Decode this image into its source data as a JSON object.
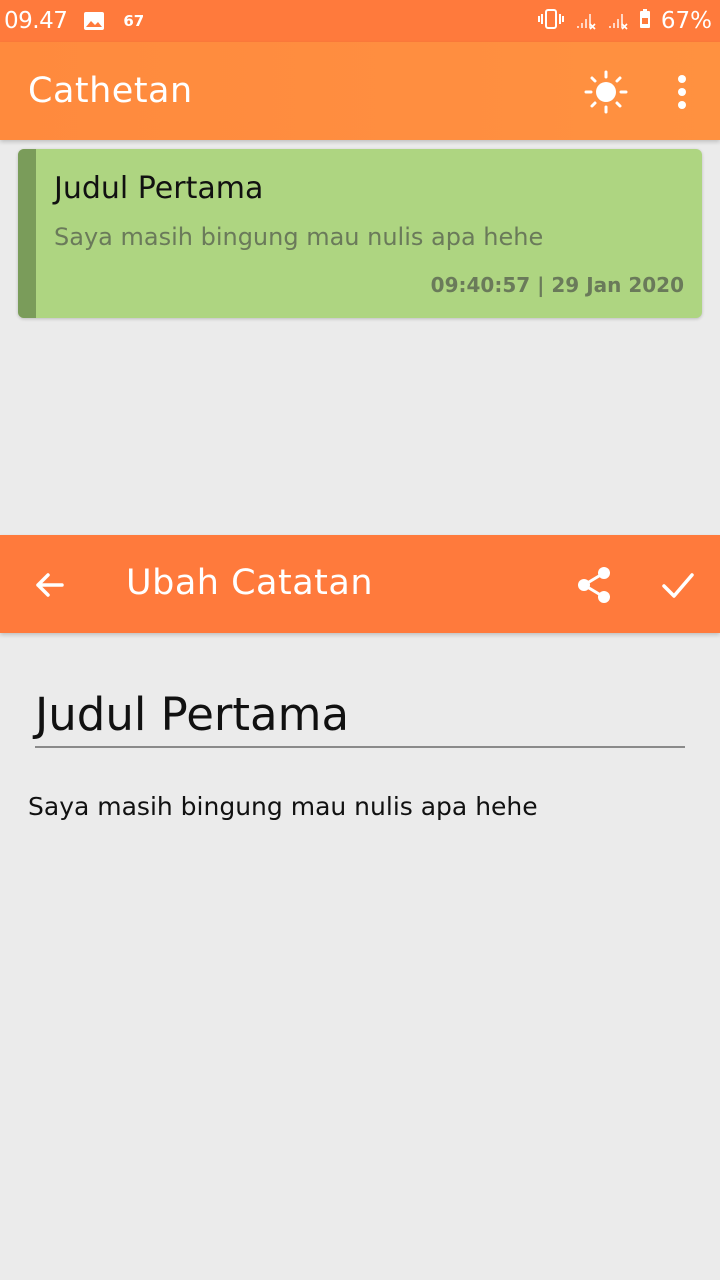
{
  "status_bar": {
    "time": "09.47",
    "notification_count": "67",
    "battery": "67%",
    "icons": [
      "image-icon",
      "vibrate-icon",
      "signal-icon",
      "signal-icon",
      "battery-icon"
    ]
  },
  "app_bar": {
    "title": "Cathetan",
    "theme_icon": "sun-icon",
    "menu_icon": "more-vert-icon"
  },
  "notes": [
    {
      "title": "Judul Pertama",
      "body": "Saya masih bingung mau nulis apa hehe",
      "timestamp": "09:40:57 | 29 Jan 2020",
      "color": "#aed581"
    }
  ],
  "edit_sheet": {
    "title": "Ubah Catatan",
    "back_icon": "arrow-back-icon",
    "share_icon": "share-icon",
    "save_icon": "check-icon",
    "note_title_value": "Judul Pertama",
    "note_body_value": "Saya masih bingung mau nulis apa hehe"
  },
  "colors": {
    "accent": "#ff7a3c",
    "note_green": "#aed581",
    "background": "#ebebeb"
  }
}
